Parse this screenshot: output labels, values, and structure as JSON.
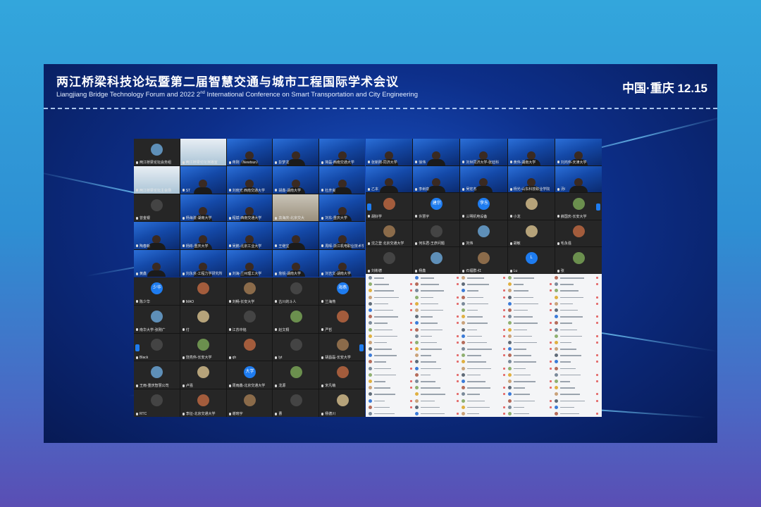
{
  "header": {
    "title_cn": "两江桥梁科技论坛暨第二届智慧交通与城市工程国际学术会议",
    "title_en": "Liangjiang Bridge Technology Forum and 2022 2",
    "title_en_sup": "nd",
    "title_en_rest": " International Conference on Smart Transportation and City Engineering",
    "location_date": "中国·重庆  12.15"
  },
  "grid_left_top": {
    "tiles": [
      {
        "label": "两江桥梁论坛会务组",
        "kind": "av",
        "av": "a2"
      },
      {
        "label": "两江桥梁论坛演播室",
        "kind": "bright"
      },
      {
        "label": "蒋刚（Newtsun）",
        "kind": "cam"
      },
      {
        "label": "彭梦龙",
        "kind": "cam"
      },
      {
        "label": "简磊-西南交通大学",
        "kind": "cam"
      },
      {
        "label": "两江桥梁论坛主会场",
        "kind": "bright"
      },
      {
        "label": "ST",
        "kind": "cam"
      },
      {
        "label": "刘晓光 西南交通大学",
        "kind": "cam"
      },
      {
        "label": "胡鑫-湖南大学",
        "kind": "cam"
      },
      {
        "label": "杜彦良",
        "kind": "cam"
      },
      {
        "label": "曾金银",
        "kind": "av",
        "av": "a6"
      },
      {
        "label": "杨海波-湖南大学",
        "kind": "cam"
      },
      {
        "label": "程斌-西南交通大学",
        "kind": "cam"
      },
      {
        "label": "袁海庆-北京交大",
        "kind": "room"
      },
      {
        "label": "刘东-重庆大学",
        "kind": "cam"
      },
      {
        "label": "陶春新",
        "kind": "cam"
      },
      {
        "label": "杨彬-重庆大学",
        "kind": "cam"
      },
      {
        "label": "吴鹏-北京工业大学",
        "kind": "cam"
      },
      {
        "label": "王继宝",
        "kind": "cam"
      },
      {
        "label": "周晖-浙江机电职业技术学院",
        "kind": "cam"
      },
      {
        "label": "黄鑫",
        "kind": "cam"
      },
      {
        "label": "刘永京-工程力学研究所",
        "kind": "cam"
      },
      {
        "label": "刘海-兰州理工大学",
        "kind": "cam"
      },
      {
        "label": "詹锐-湖南大学",
        "kind": "cam"
      },
      {
        "label": "刘吉文-湖南大学",
        "kind": "cam"
      }
    ]
  },
  "grid_right_top": {
    "tiles": [
      {
        "label": "张新刚-同济大学",
        "kind": "cam"
      },
      {
        "label": "徐伟",
        "kind": "cam"
      },
      {
        "label": "刘世同济大学-张廷科",
        "kind": "cam"
      },
      {
        "label": "黄伟-湖南大学",
        "kind": "cam"
      },
      {
        "label": "刘鸿伟-天津大学",
        "kind": "cam"
      },
      {
        "label": "乙本",
        "kind": "cam"
      },
      {
        "label": "李树泉",
        "kind": "cam"
      },
      {
        "label": "吴宏杰",
        "kind": "cam"
      },
      {
        "label": "杨光-山东科技职业学院",
        "kind": "cam"
      },
      {
        "label": "汤l",
        "kind": "cam"
      },
      {
        "label": "胡好学",
        "kind": "av",
        "av": "a4"
      },
      {
        "label": "许慧宇",
        "kind": "av",
        "text": "建宗"
      },
      {
        "label": "三明机电设备",
        "kind": "av",
        "text": "李东"
      },
      {
        "label": "小龙",
        "kind": "av",
        "av": "a3"
      },
      {
        "label": "薛国庆-长安大学",
        "kind": "av",
        "av": "a5"
      },
      {
        "label": "沈之登 北京交通大学",
        "kind": "av",
        "av": "a1"
      },
      {
        "label": "何东君-王彦问题",
        "kind": "av",
        "av": "a6"
      },
      {
        "label": "刘伟",
        "kind": "av",
        "av": "a2"
      },
      {
        "label": "胡敏",
        "kind": "av",
        "av": "a3"
      },
      {
        "label": "毛永强",
        "kind": "av",
        "av": "a4"
      },
      {
        "label": "刘彬德",
        "kind": "av",
        "av": "a6"
      },
      {
        "label": "杨鑫",
        "kind": "av",
        "av": "a2"
      },
      {
        "label": "石福群-红",
        "kind": "av",
        "av": "a1"
      },
      {
        "label": "Lu",
        "kind": "av",
        "text": "L"
      },
      {
        "label": "张",
        "kind": "av",
        "av": "a5"
      }
    ]
  },
  "grid_left_bottom": {
    "tiles": [
      {
        "label": "陈少华",
        "kind": "av",
        "text": "少华"
      },
      {
        "label": "MAO",
        "kind": "av",
        "av": "a4"
      },
      {
        "label": "刘畅-长安大学",
        "kind": "av",
        "av": "a1"
      },
      {
        "label": "古川的斗人",
        "kind": "av",
        "av": "a6"
      },
      {
        "label": "兰海燕",
        "kind": "av",
        "text": "海燕"
      },
      {
        "label": "南华大学-张刚广",
        "kind": "av",
        "av": "a2"
      },
      {
        "label": "付",
        "kind": "av",
        "av": "a3"
      },
      {
        "label": "江苏中铭",
        "kind": "av",
        "av": "a6"
      },
      {
        "label": "赵文桐",
        "kind": "av",
        "av": "a5"
      },
      {
        "label": "严哲",
        "kind": "av",
        "av": "a4"
      },
      {
        "label": "Black",
        "kind": "av",
        "av": "a6"
      },
      {
        "label": "饶亮伟-长安大学",
        "kind": "av",
        "av": "a5"
      },
      {
        "label": "qh",
        "kind": "av",
        "av": "a4"
      },
      {
        "label": "lyt",
        "kind": "av",
        "av": "a6"
      },
      {
        "label": "胡昌磊-长安大学",
        "kind": "av",
        "av": "a1"
      },
      {
        "label": "王雨-重庆智慧公司",
        "kind": "av",
        "av": "a2"
      },
      {
        "label": "卢强",
        "kind": "av",
        "av": "a3"
      },
      {
        "label": "周雨鑫-北京交通大学",
        "kind": "av",
        "text": "大学"
      },
      {
        "label": "龙源",
        "kind": "av",
        "av": "a5"
      },
      {
        "label": "宋凡萌",
        "kind": "av",
        "av": "a4"
      },
      {
        "label": "RTC",
        "kind": "av",
        "av": "a6"
      },
      {
        "label": "李征-北京交通大学",
        "kind": "av",
        "av": "a4"
      },
      {
        "label": "谢晓宇",
        "kind": "av",
        "av": "a1"
      },
      {
        "label": "曹",
        "kind": "av",
        "av": "a6"
      },
      {
        "label": "杨德川",
        "kind": "av",
        "av": "a3"
      }
    ]
  }
}
